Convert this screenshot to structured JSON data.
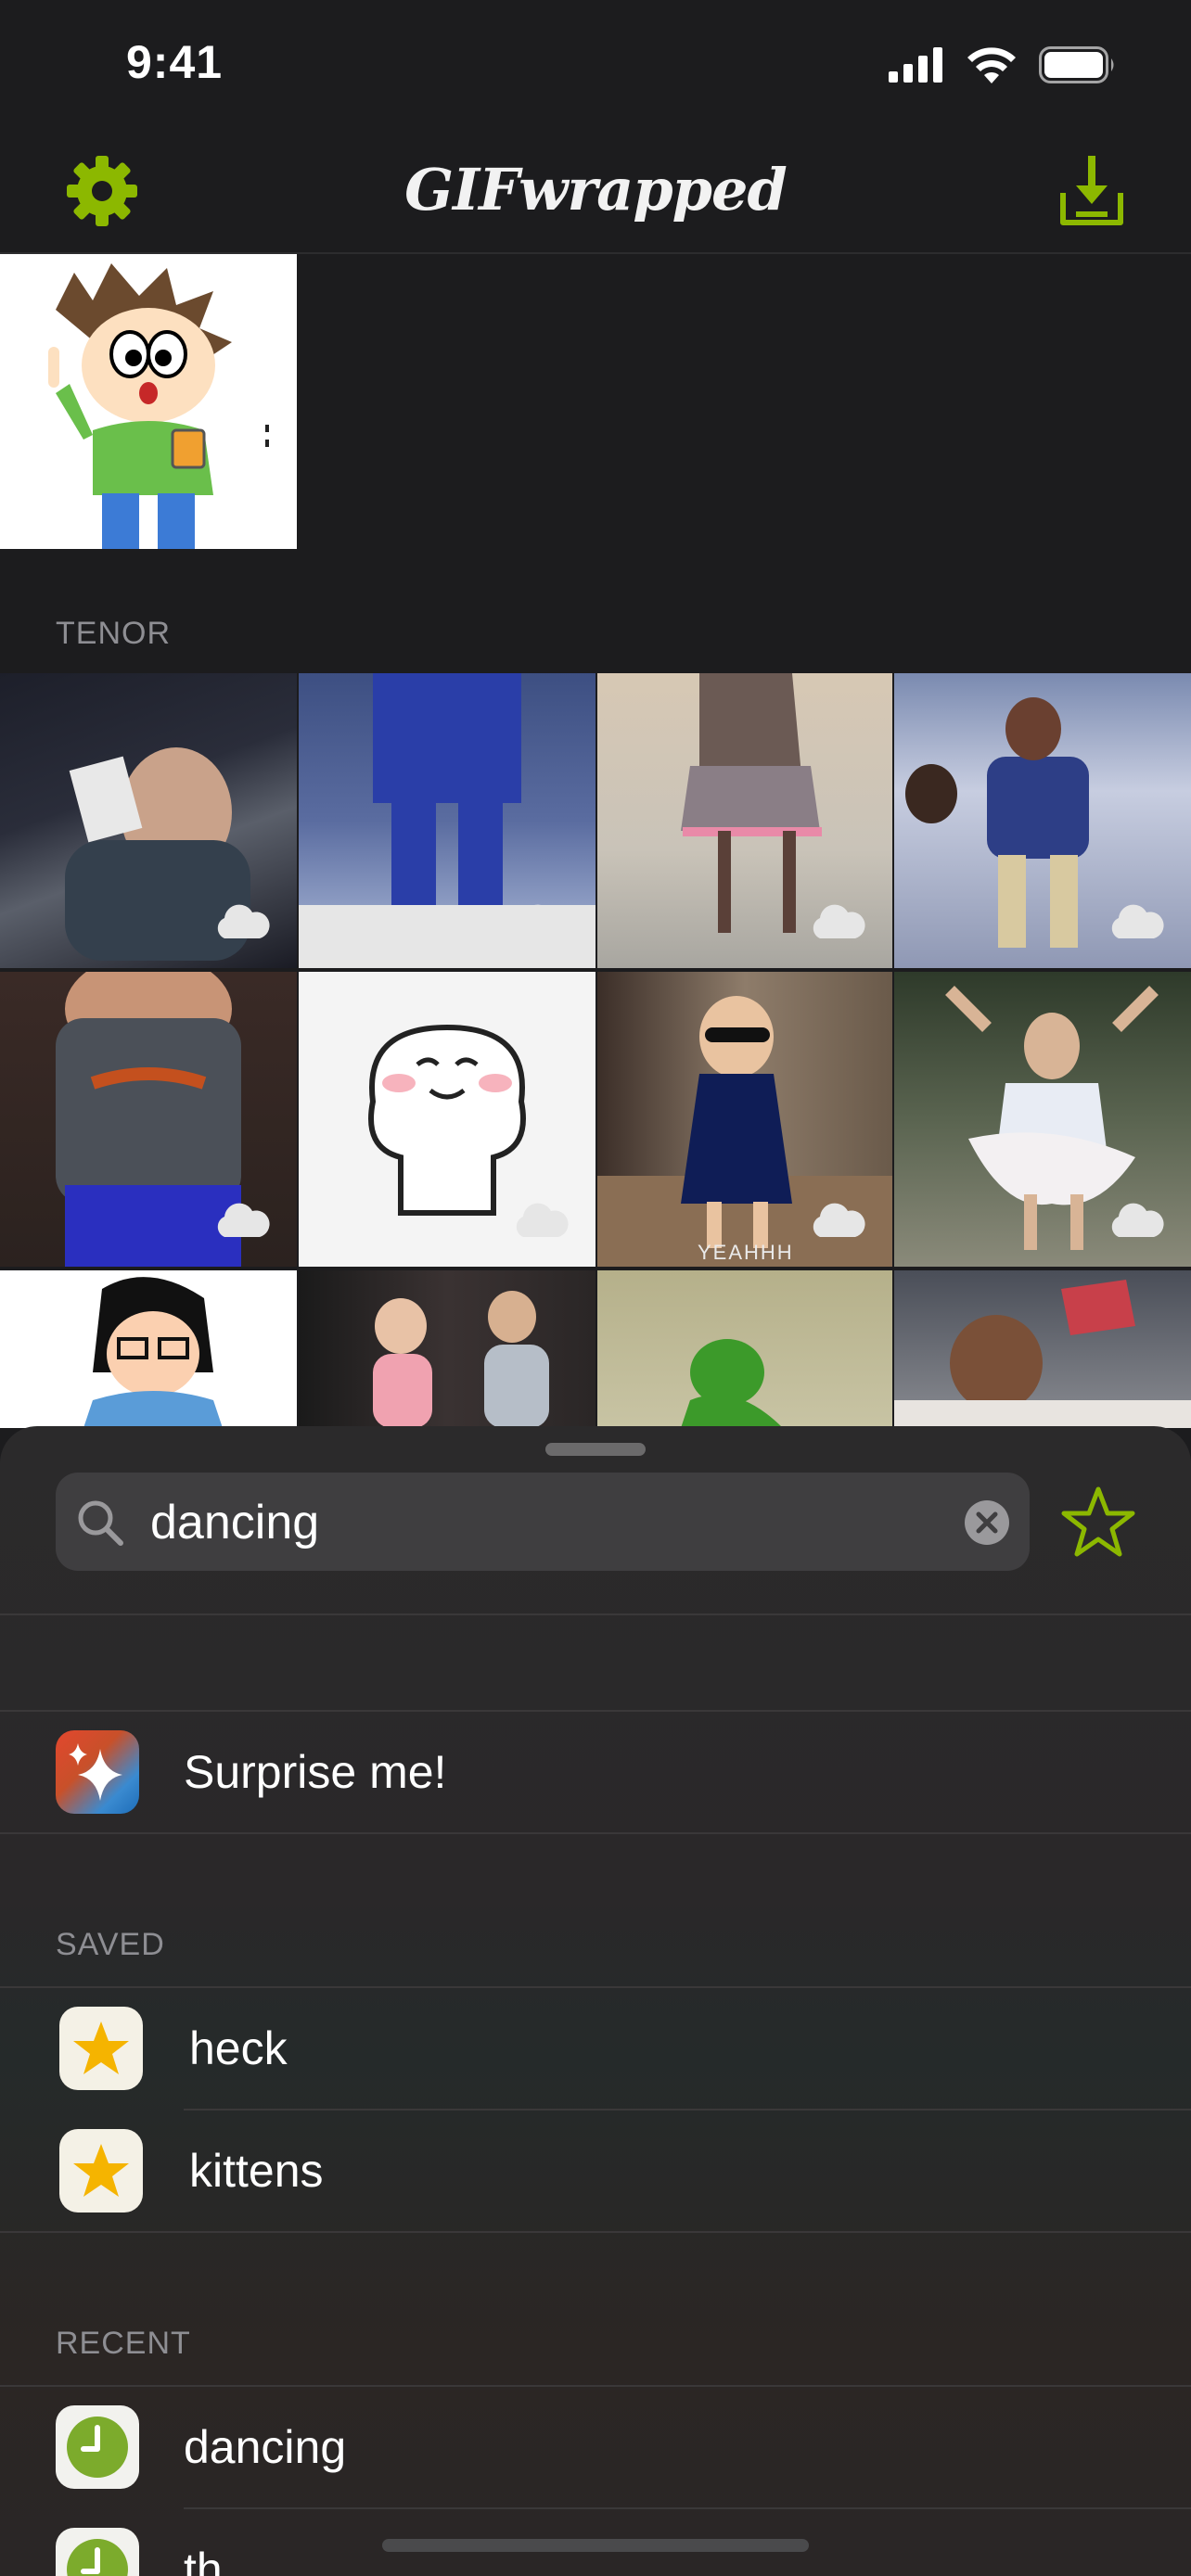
{
  "status": {
    "time": "9:41"
  },
  "nav": {
    "title": "GIFwrapped"
  },
  "sections": {
    "tenor": "TENOR"
  },
  "search": {
    "query": "dancing"
  },
  "surprise": {
    "label": "Surprise me!"
  },
  "saved": {
    "header": "SAVED",
    "items": [
      "heck",
      "kittens"
    ]
  },
  "recent": {
    "header": "RECENT",
    "items": [
      "dancing",
      "th"
    ]
  },
  "gif_captions": {
    "yeahhh": "YEAHHH"
  },
  "colors": {
    "accent": "#8cb800",
    "background": "#1c1c1e",
    "star": "#f5b400",
    "clock": "#7cab2c"
  }
}
